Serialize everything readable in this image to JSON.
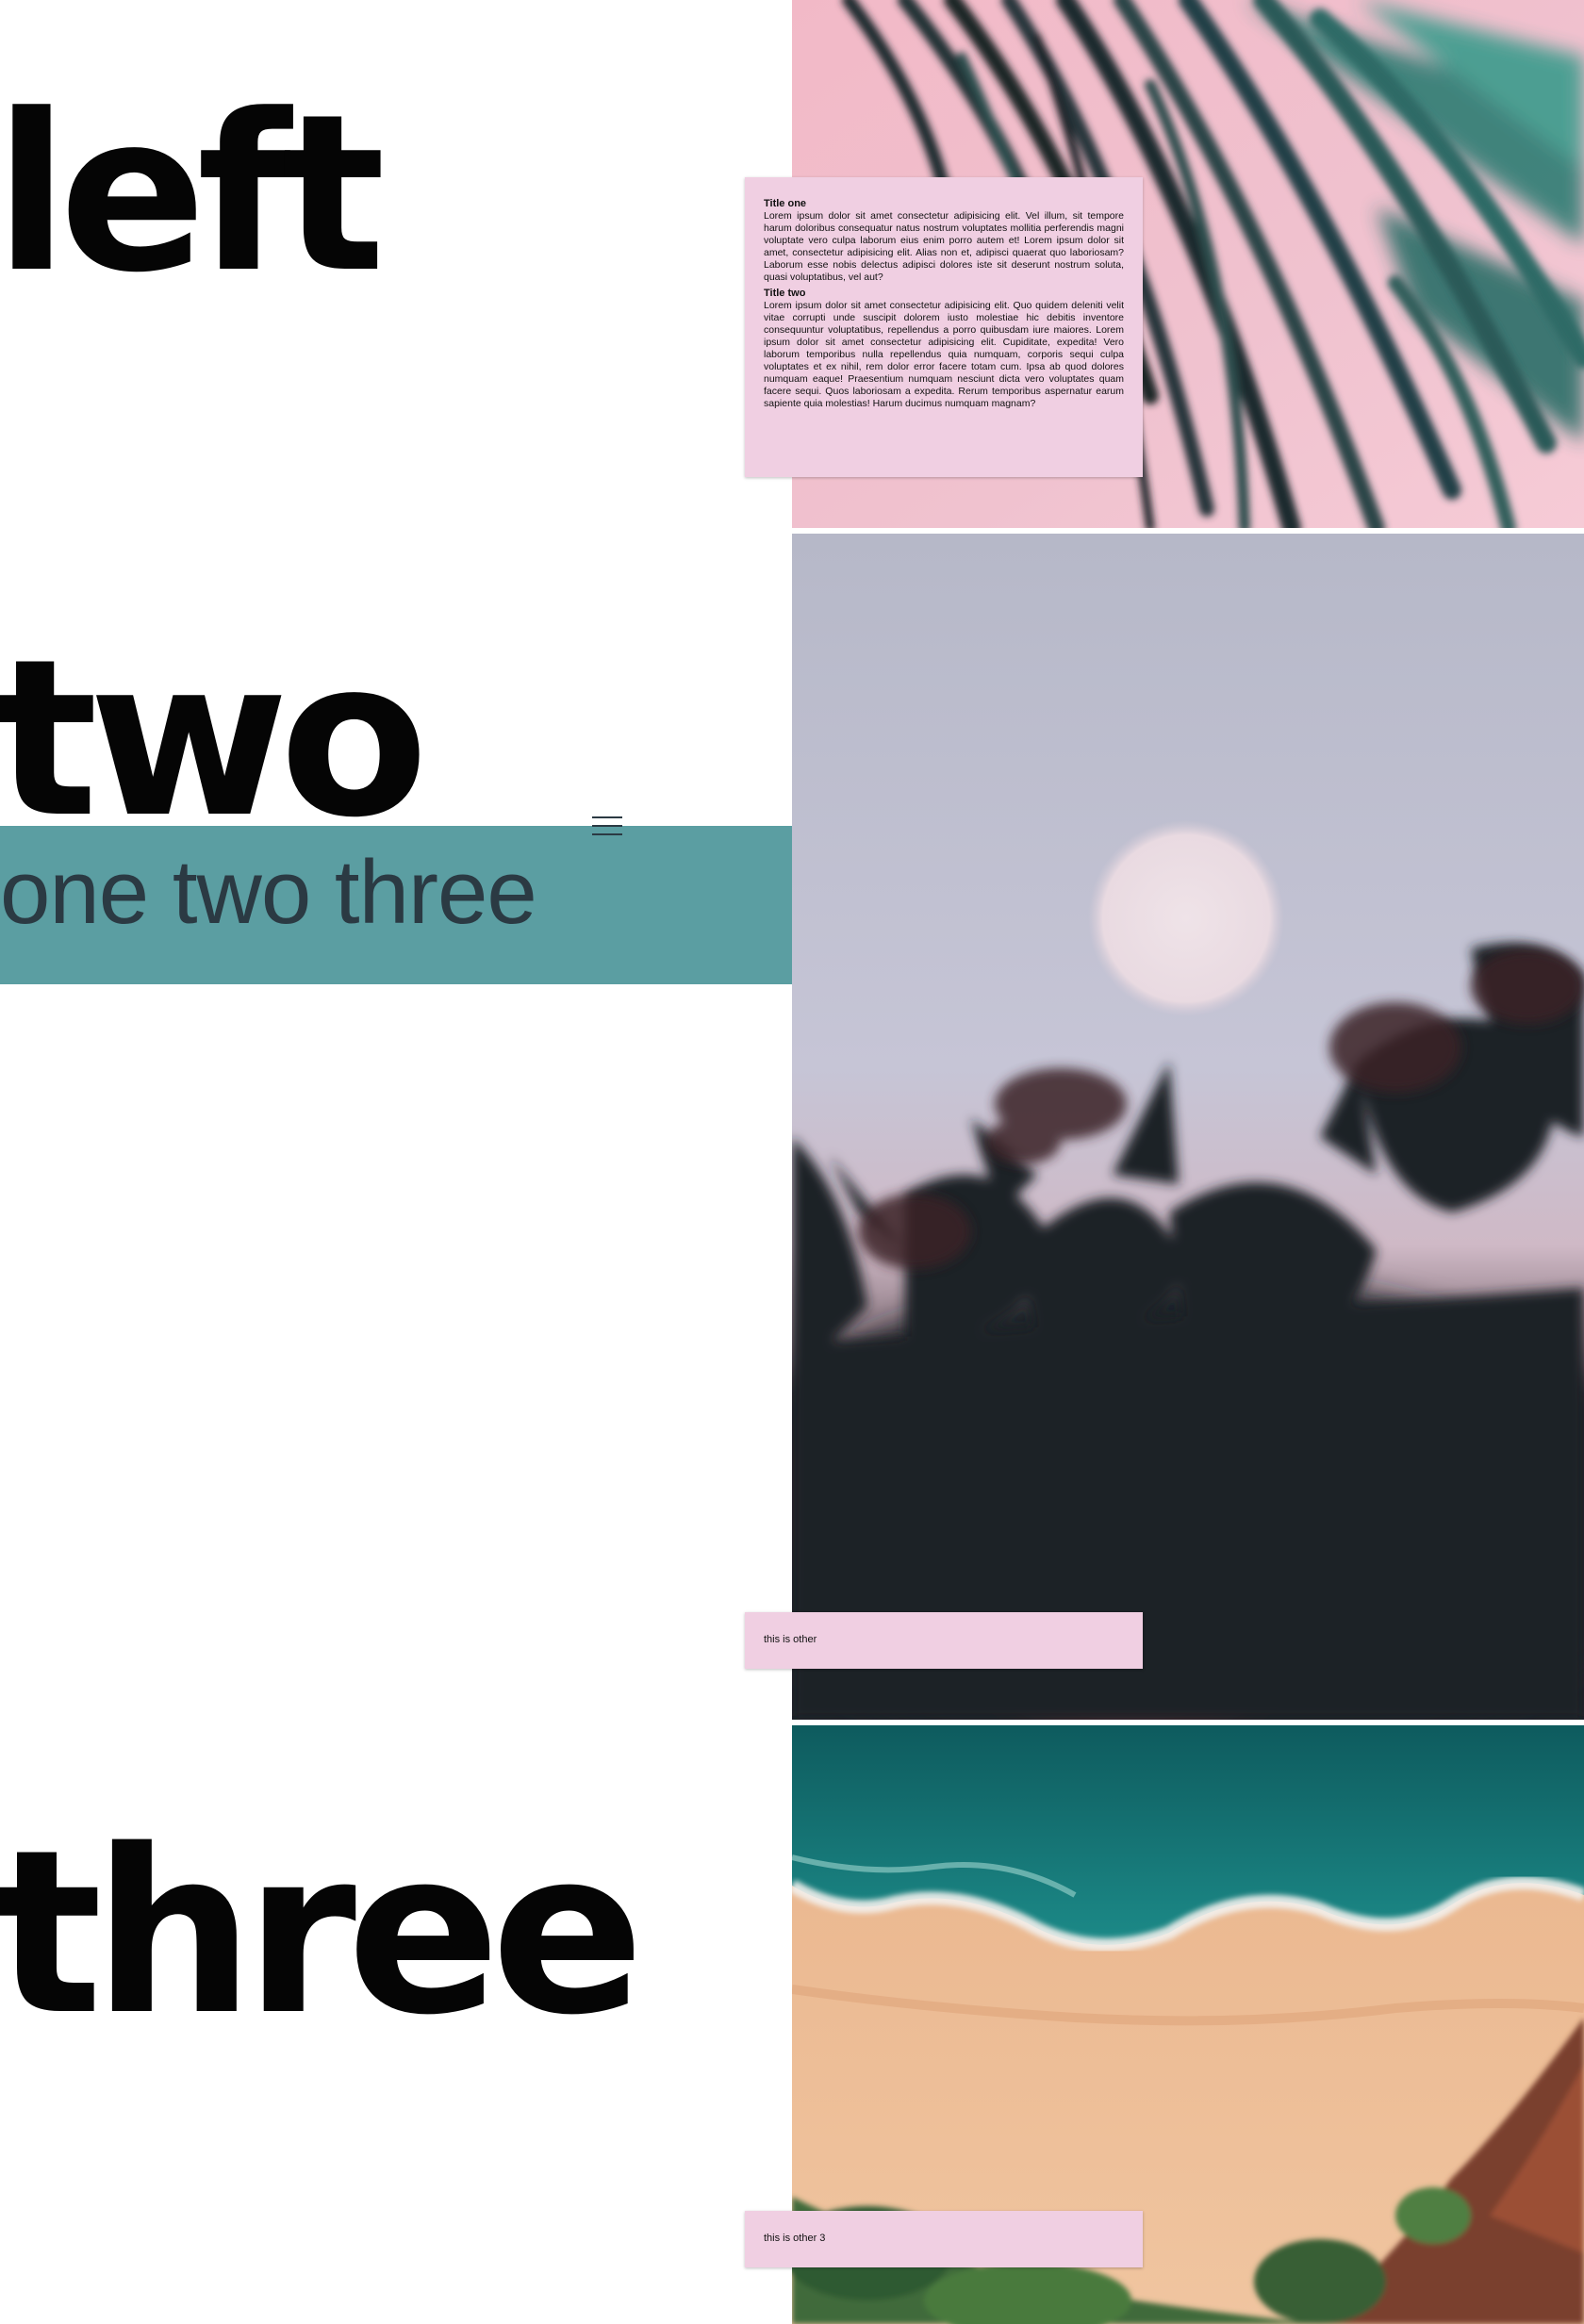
{
  "headings": {
    "first": "left",
    "second": "two",
    "third": "three"
  },
  "band": {
    "text": "one two three",
    "color": "#5b9ea2"
  },
  "menu": {
    "icon": "hamburger-menu-icon"
  },
  "cards": {
    "first": {
      "title_one": "Title one",
      "body_one": "Lorem ipsum dolor sit amet consectetur adipisicing elit. Vel illum, sit tempore harum doloribus consequatur natus nostrum voluptates mollitia perferendis magni voluptate vero culpa laborum eius enim porro autem et! Lorem ipsum dolor sit amet, consectetur adipisicing elit. Alias non et, adipisci quaerat quo laboriosam? Laborum esse nobis delectus adipisci dolores iste sit deserunt nostrum soluta, quasi voluptatibus, vel aut?",
      "title_two": "Title two",
      "body_two": "Lorem ipsum dolor sit amet consectetur adipisicing elit. Quo quidem deleniti velit vitae corrupti unde suscipit dolorem iusto molestiae hic debitis inventore consequuntur voluptatibus, repellendus a porro quibusdam iure maiores. Lorem ipsum dolor sit amet consectetur adipisicing elit. Cupiditate, expedita! Vero laborum temporibus nulla repellendus quia numquam, corporis sequi culpa voluptates et ex nihil, rem dolor error facere totam cum. Ipsa ab quod dolores numquam eaque! Praesentium numquam nesciunt dicta vero voluptates quam facere sequi. Quos laboriosam a expedita. Rerum temporibus aspernatur earum sapiente quia molestias! Harum ducimus numquam magnam?"
    },
    "second": {
      "text": "this is other"
    },
    "third": {
      "text": "this is other 3"
    }
  },
  "colors": {
    "card_background": "#f0cfe2",
    "heading": "#050505",
    "band_text": "#2b3a43"
  }
}
